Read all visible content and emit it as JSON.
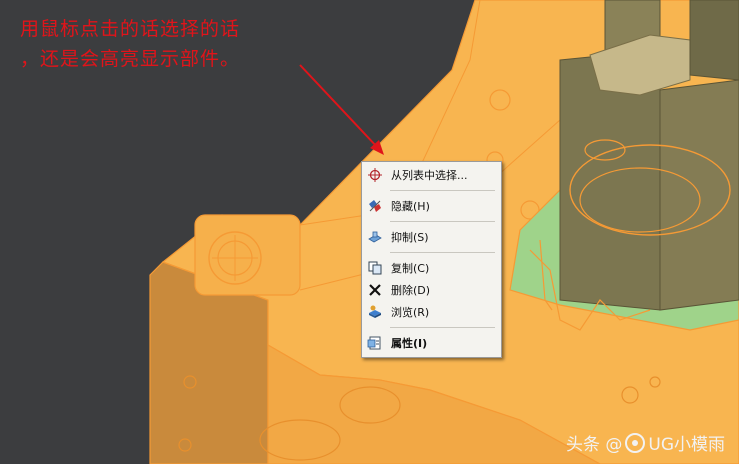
{
  "annotation": {
    "line1": "用鼠标点击的话选择的话",
    "line2": "，还是会高亮显示部件。",
    "color": "#e0141a"
  },
  "context_menu": {
    "items": [
      {
        "label": "从列表中选择...",
        "icon": "crosshair-icon"
      },
      {
        "label": "隐藏(H)",
        "icon": "hide-icon"
      },
      {
        "label": "抑制(S)",
        "icon": "suppress-icon"
      },
      {
        "label": "复制(C)",
        "icon": "copy-icon"
      },
      {
        "label": "删除(D)",
        "icon": "delete-icon"
      },
      {
        "label": "浏览(R)",
        "icon": "browse-icon"
      },
      {
        "label": "属性(I)",
        "icon": "properties-icon"
      }
    ]
  },
  "watermark": {
    "prefix": "头条 @",
    "suffix": "UG小模雨"
  },
  "colors": {
    "background": "#3c3d3f",
    "part_orange": "#f7b24c",
    "wire_orange": "#f59a35",
    "core_olive": "#7c7650",
    "highlight_green": "#9fd38a"
  }
}
